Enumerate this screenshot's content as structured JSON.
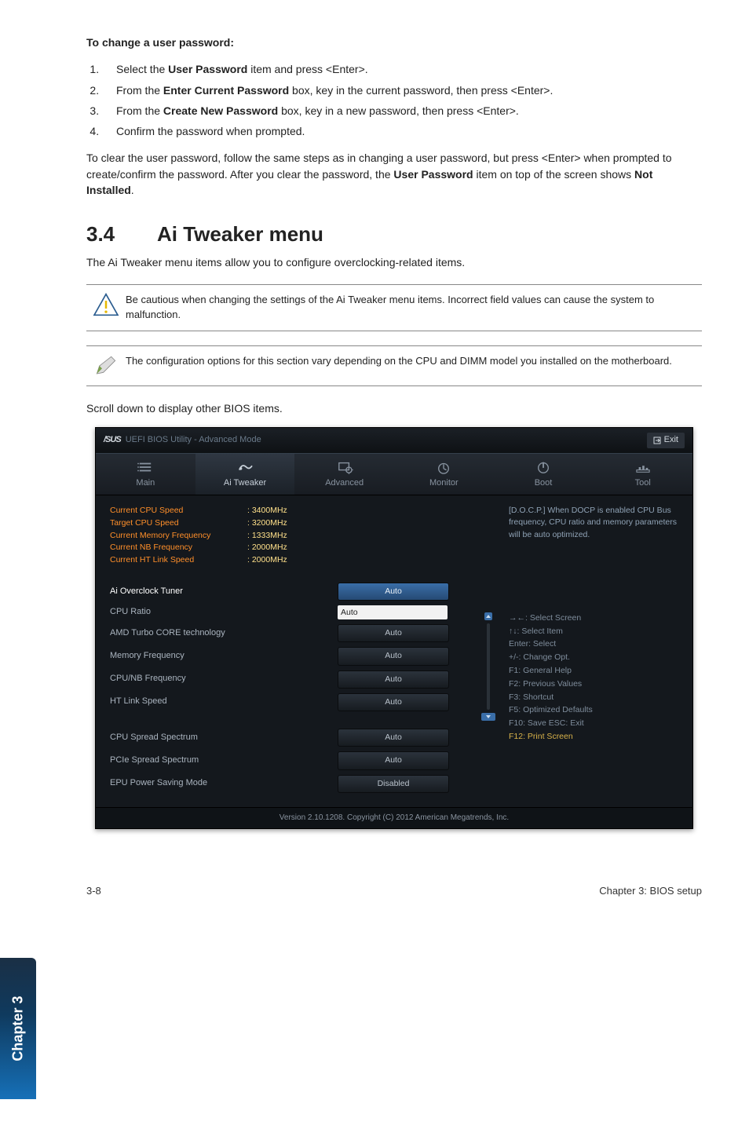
{
  "doc": {
    "change_pw_heading": "To change a user password:",
    "steps": [
      {
        "pre": "Select the ",
        "bold": "User Password",
        "post": " item and press <Enter>."
      },
      {
        "pre": "From the ",
        "bold": "Enter Current Password",
        "post": " box, key in the current password, then press <Enter>."
      },
      {
        "pre": "From the ",
        "bold": "Create New Password",
        "post": " box, key in a new password, then press <Enter>."
      },
      {
        "pre": "Confirm the password when prompted.",
        "bold": "",
        "post": ""
      }
    ],
    "clear_text_pre": "To clear the user password, follow the same steps as in changing a user password, but press <Enter> when prompted to create/confirm the password. After you clear the password, the ",
    "clear_bold1": "User Password",
    "clear_mid": " item on top of the screen shows ",
    "clear_bold2": "Not Installed",
    "clear_end": ".",
    "section_num": "3.4",
    "section_title": "Ai Tweaker menu",
    "section_sub": "The Ai Tweaker menu items allow you to configure overclocking-related items.",
    "caution": "Be cautious when changing the settings of the Ai Tweaker menu items. Incorrect field values can cause the system to malfunction.",
    "note": "The configuration options for this section vary depending on the CPU and DIMM model you installed on the motherboard.",
    "scroll_note": "Scroll down to display other BIOS items."
  },
  "bios": {
    "brand": "/SUS",
    "utility_title": "UEFI BIOS Utility - Advanced Mode",
    "exit_label": "Exit",
    "tabs": [
      "Main",
      "Ai Tweaker",
      "Advanced",
      "Monitor",
      "Boot",
      "Tool"
    ],
    "active_tab_index": 1,
    "info": [
      {
        "label": "Current CPU Speed",
        "value": ": 3400MHz"
      },
      {
        "label": "Target CPU Speed",
        "value": ": 3200MHz"
      },
      {
        "label": "Current Memory Frequency",
        "value": ": 1333MHz"
      },
      {
        "label": "Current NB Frequency",
        "value": ": 2000MHz"
      },
      {
        "label": "Current HT Link Speed",
        "value": ": 2000MHz"
      }
    ],
    "rows": [
      {
        "name": "Ai Overclock Tuner",
        "value": "Auto",
        "type": "highlight"
      },
      {
        "name": "CPU Ratio",
        "value": "Auto",
        "type": "input"
      },
      {
        "name": "AMD Turbo CORE technology",
        "value": "Auto",
        "type": "button"
      },
      {
        "name": "Memory Frequency",
        "value": "Auto",
        "type": "button"
      },
      {
        "name": "CPU/NB Frequency",
        "value": "Auto",
        "type": "button"
      },
      {
        "name": "HT Link Speed",
        "value": "Auto",
        "type": "button"
      },
      {
        "name": "CPU Spread Spectrum",
        "value": "Auto",
        "type": "button"
      },
      {
        "name": "PCIe Spread Spectrum",
        "value": "Auto",
        "type": "button"
      },
      {
        "name": "EPU Power Saving Mode",
        "value": "Disabled",
        "type": "button"
      }
    ],
    "right_desc": "[D.O.C.P.] When DOCP is enabled CPU Bus frequency, CPU ratio and memory parameters will be auto optimized.",
    "help": [
      "→←: Select Screen",
      "↑↓: Select Item",
      "Enter: Select",
      "+/-: Change Opt.",
      "F1: General Help",
      "F2: Previous Values",
      "F3: Shortcut",
      "F5: Optimized Defaults",
      "F10: Save   ESC: Exit",
      "F12: Print Screen"
    ],
    "footer": "Version 2.10.1208.   Copyright (C) 2012 American Megatrends, Inc."
  },
  "side_tab": "Chapter 3",
  "page_footer_left": "3-8",
  "page_footer_right": "Chapter 3: BIOS setup"
}
